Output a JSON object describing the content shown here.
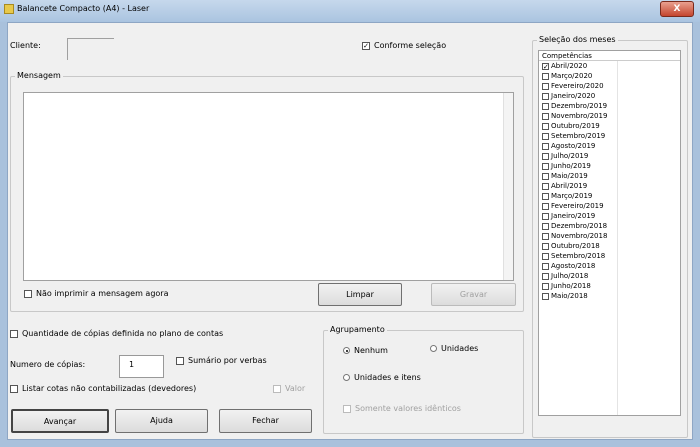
{
  "window": {
    "title": "Balancete Compacto (A4) - Laser",
    "close_label": "X"
  },
  "cliente": {
    "label": "Cliente:",
    "value": ""
  },
  "conforme": {
    "label": "Conforme seleção",
    "checked": true
  },
  "mensagem": {
    "legend": "Mensagem",
    "text": "",
    "nao_imprimir": "Não imprimir a mensagem agora",
    "limpar": "Limpar",
    "gravar": "Gravar"
  },
  "quantidade": {
    "label": "Quantidade de cópias definida no plano de contas",
    "checked": false
  },
  "copias": {
    "label": "Numero de cópias:",
    "value": "1"
  },
  "sumario": {
    "label": "Sumário por verbas",
    "checked": false
  },
  "listar": {
    "label": "Listar cotas não contabilizadas (devedores)",
    "checked": false
  },
  "valor": {
    "label": "Valor",
    "checked": false
  },
  "buttons": {
    "avancar": "Avançar",
    "ajuda": "Ajuda",
    "fechar": "Fechar"
  },
  "agrupamento": {
    "legend": "Agrupamento",
    "nenhum": "Nenhum",
    "unidades": "Unidades",
    "unidades_itens": "Unidades e itens",
    "somente": "Somente valores idênticos",
    "selected": "Nenhum"
  },
  "meses": {
    "legend": "Seleção dos meses",
    "header": "Competências",
    "items": [
      {
        "label": "Abril/2020",
        "checked": true
      },
      {
        "label": "Março/2020",
        "checked": false
      },
      {
        "label": "Fevereiro/2020",
        "checked": false
      },
      {
        "label": "Janeiro/2020",
        "checked": false
      },
      {
        "label": "Dezembro/2019",
        "checked": false
      },
      {
        "label": "Novembro/2019",
        "checked": false
      },
      {
        "label": "Outubro/2019",
        "checked": false
      },
      {
        "label": "Setembro/2019",
        "checked": false
      },
      {
        "label": "Agosto/2019",
        "checked": false
      },
      {
        "label": "Julho/2019",
        "checked": false
      },
      {
        "label": "Junho/2019",
        "checked": false
      },
      {
        "label": "Maio/2019",
        "checked": false
      },
      {
        "label": "Abril/2019",
        "checked": false
      },
      {
        "label": "Março/2019",
        "checked": false
      },
      {
        "label": "Fevereiro/2019",
        "checked": false
      },
      {
        "label": "Janeiro/2019",
        "checked": false
      },
      {
        "label": "Dezembro/2018",
        "checked": false
      },
      {
        "label": "Novembro/2018",
        "checked": false
      },
      {
        "label": "Outubro/2018",
        "checked": false
      },
      {
        "label": "Setembro/2018",
        "checked": false
      },
      {
        "label": "Agosto/2018",
        "checked": false
      },
      {
        "label": "Julho/2018",
        "checked": false
      },
      {
        "label": "Junho/2018",
        "checked": false
      },
      {
        "label": "Maio/2018",
        "checked": false
      }
    ]
  }
}
